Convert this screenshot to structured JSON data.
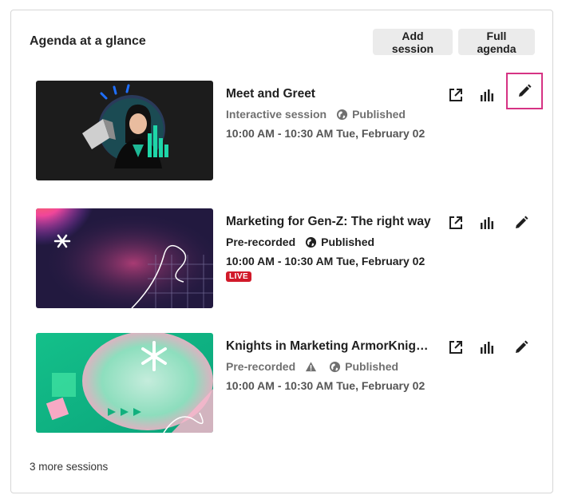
{
  "panel": {
    "title": "Agenda at a glance",
    "add_session_label": "Add session",
    "full_agenda_label": "Full agenda",
    "more_sessions": "3 more sessions"
  },
  "sessions": [
    {
      "title": "Meet and Greet",
      "type": "Interactive session",
      "status": "Published",
      "time": "10:00 AM - 10:30 AM",
      "date": "Tue, February 02",
      "badge": "",
      "warning": false,
      "edit_focused": true
    },
    {
      "title": "Marketing for Gen-Z: The right way",
      "type": "Pre-recorded",
      "status": "Published",
      "time": "10:00 AM - 10:30 AM",
      "date": "Tue, February 02",
      "badge": "LIVE",
      "warning": false,
      "edit_focused": false
    },
    {
      "title": "Knights in Marketing ArmorKnight...",
      "type": "Pre-recorded",
      "status": "Published",
      "time": "10:00 AM - 10:30 AM",
      "date": "Tue, February 02",
      "badge": "",
      "warning": true,
      "edit_focused": false
    }
  ],
  "icons": {
    "open": "external-link-icon",
    "stats": "bar-chart-icon",
    "edit": "pencil-icon",
    "published": "globe-icon",
    "warning": "warning-icon"
  },
  "colors": {
    "focus_outline": "#d63384",
    "live_badge": "#d11a2a",
    "button_bg": "#ebebeb"
  }
}
